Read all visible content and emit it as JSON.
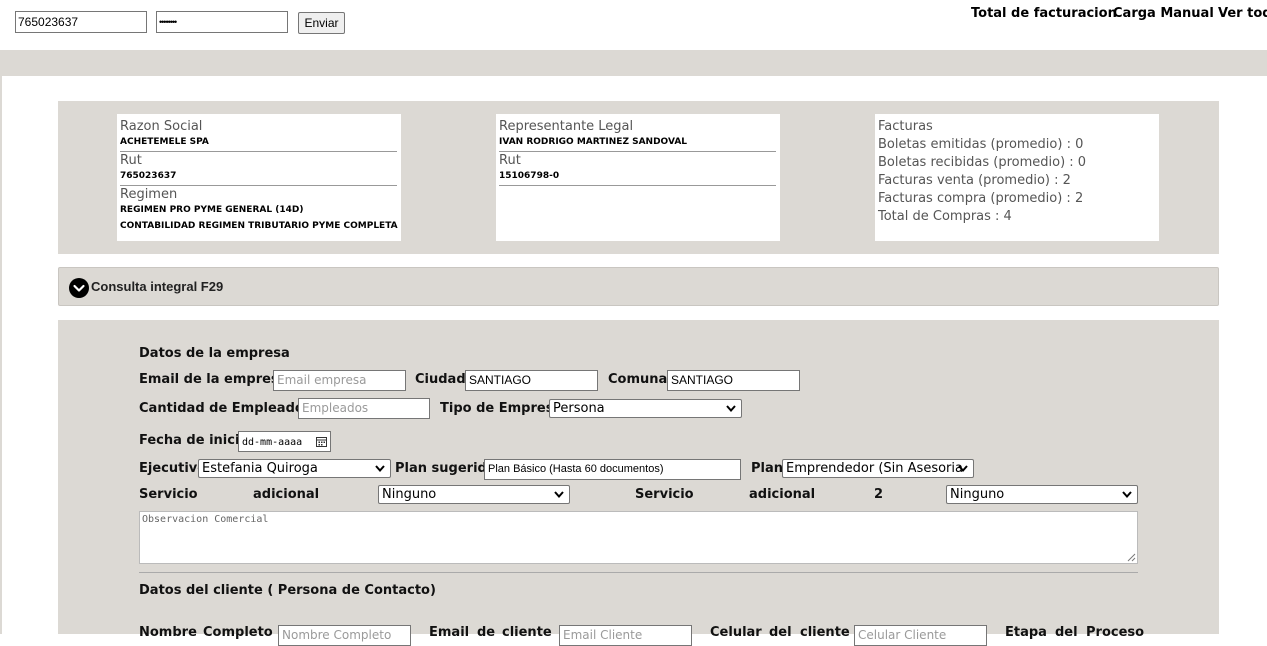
{
  "login": {
    "rut_value": "765023637",
    "password_value": "••••••••",
    "submit_label": "Enviar"
  },
  "nav": {
    "items": [
      "Total de facturacion",
      "Carga Manual",
      "Ver todo"
    ]
  },
  "company_card": {
    "razon_label": "Razon Social",
    "razon_value": "ACHETEMELE SPA",
    "rut_label": "Rut",
    "rut_value": "765023637",
    "regimen_label": "Regimen",
    "regimen_value1": "REGIMEN PRO PYME GENERAL (14D)",
    "regimen_value2": "CONTABILIDAD REGIMEN TRIBUTARIO PYME COMPLETA"
  },
  "rep_card": {
    "rep_label": "Representante Legal",
    "rep_value": "IVAN RODRIGO MARTINEZ SANDOVAL",
    "rut_label": "Rut",
    "rut_value": "15106798-0"
  },
  "facturas_card": {
    "title": "Facturas",
    "lines": [
      "Boletas emitidas (promedio) : 0",
      "Boletas recibidas (promedio) : 0",
      "Facturas venta (promedio) : 2",
      "Facturas compra (promedio) : 2",
      "Total de Compras : 4"
    ]
  },
  "accordion": {
    "title": "Consulta integral F29"
  },
  "form": {
    "section_empresa": "Datos de la empresa",
    "email_label": "Email de la empresa",
    "email_placeholder": "Email empresa",
    "ciudad_label": "Ciudad",
    "ciudad_value": "SANTIAGO",
    "comuna_label": "Comuna",
    "comuna_value": "SANTIAGO",
    "empleados_label": "Cantidad de Empleados",
    "empleados_placeholder": "Empleados",
    "tipo_label": "Tipo de Empresa",
    "tipo_value": "Persona",
    "fecha_label": "Fecha de inicio",
    "fecha_placeholder": "dd-mm-aaaa",
    "ejecutivo_label": "Ejecutivo",
    "ejecutivo_value": "Estefania Quiroga",
    "plan_sugerido_label": "Plan sugerido",
    "plan_sugerido_value": "Plan Básico (Hasta 60 documentos)",
    "plan_label": "Plan",
    "plan_value": "Emprendedor (Sin Asesoria",
    "servicio1_word1": "Servicio",
    "servicio1_word2": "adicional",
    "servicio1_value": "Ninguno",
    "servicio2_word1": "Servicio",
    "servicio2_word2": "adicional",
    "servicio2_word3": "2",
    "servicio2_value": "Ninguno",
    "observacion_placeholder": "Observacion Comercial",
    "section_cliente": "Datos del cliente ( Persona de Contacto)",
    "nombre_w1": "Nombre",
    "nombre_w2": "Completo",
    "nombre_placeholder": "Nombre Completo",
    "email_cli_w1": "Email",
    "email_cli_w2": "de",
    "email_cli_w3": "cliente",
    "email_cli_placeholder": "Email Cliente",
    "celular_w1": "Celular",
    "celular_w2": "del",
    "celular_w3": "cliente",
    "celular_placeholder": "Celular Cliente",
    "etapa_w1": "Etapa",
    "etapa_w2": "del",
    "etapa_w3": "Proceso"
  }
}
